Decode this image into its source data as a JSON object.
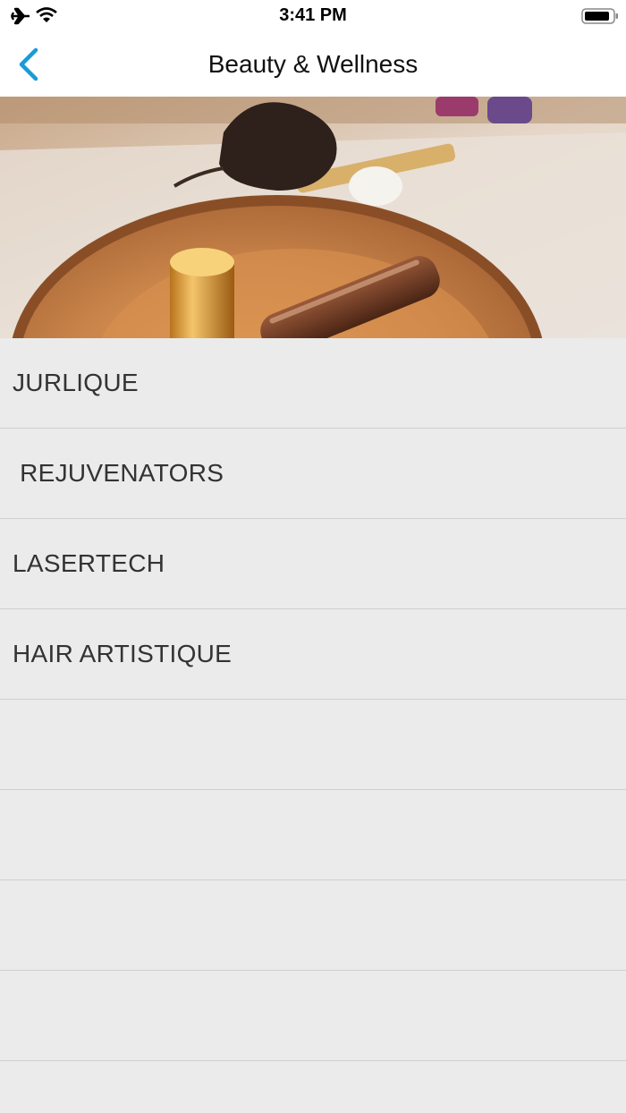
{
  "status_bar": {
    "time": "3:41 PM",
    "icons": [
      "airplane-icon",
      "wifi-icon",
      "battery-icon"
    ]
  },
  "nav": {
    "title": "Beauty & Wellness",
    "back_icon": "chevron-left-icon",
    "accent_color": "#1a9bd7"
  },
  "hero": {
    "image": "spa-essential-oils-photo"
  },
  "list": {
    "items": [
      {
        "label": "JURLIQUE"
      },
      {
        "label": " REJUVENATORS"
      },
      {
        "label": "LASERTECH"
      },
      {
        "label": "HAIR ARTISTIQUE"
      }
    ]
  }
}
